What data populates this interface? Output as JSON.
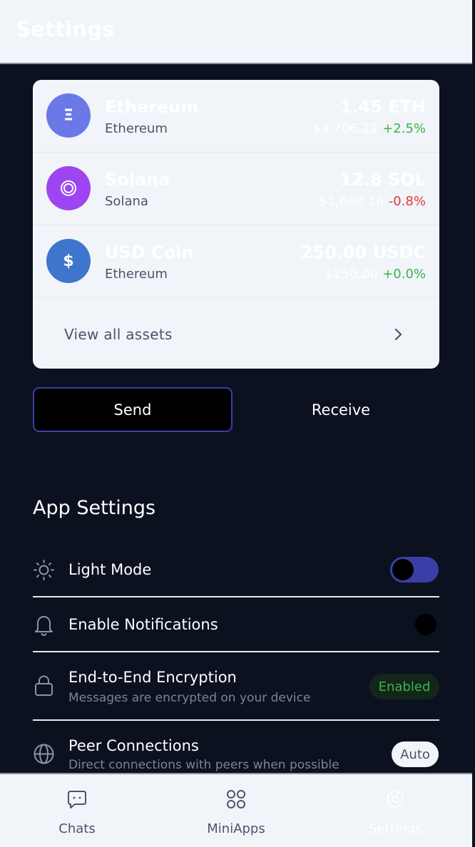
{
  "header": {
    "title": "Settings"
  },
  "assets": [
    {
      "name": "Ethereum",
      "network": "Ethereum",
      "amount": "1.45 ETH",
      "usd": "$4,706.22",
      "change": "+2.5%",
      "change_dir": "pos",
      "icon": "ethereum-icon",
      "icon_glyph": "Ξ",
      "color": "#6a78e8"
    },
    {
      "name": "Solana",
      "network": "Solana",
      "amount": "12.8 SOL",
      "usd": "$1,660.16",
      "change": "-0.8%",
      "change_dir": "neg",
      "icon": "solana-icon",
      "icon_glyph": "◎",
      "color": "#9d45f0"
    },
    {
      "name": "USD Coin",
      "network": "Ethereum",
      "amount": "250.00 USDC",
      "usd": "$250.00",
      "change": "+0.0%",
      "change_dir": "pos",
      "icon": "usd-coin-icon",
      "icon_glyph": "$",
      "color": "#3f75cc"
    }
  ],
  "view_all": {
    "label": "View all assets"
  },
  "actions": {
    "send": "Send",
    "receive": "Receive"
  },
  "app_settings": {
    "title": "App Settings",
    "light_mode": {
      "label": "Light Mode",
      "on": true
    },
    "notifications": {
      "label": "Enable Notifications",
      "on": false
    },
    "encryption": {
      "label": "End-to-End Encryption",
      "description": "Messages are encrypted on your device",
      "badge": "Enabled"
    },
    "peer": {
      "label": "Peer Connections",
      "description": "Direct connections with peers when possible",
      "badge": "Auto"
    }
  },
  "nav": {
    "items": [
      {
        "label": "Chats",
        "icon": "chat-icon"
      },
      {
        "label": "MiniApps",
        "icon": "miniapps-icon"
      },
      {
        "label": "Settings",
        "icon": "settings-icon",
        "active": true
      }
    ]
  },
  "colors": {
    "accent": "#3a3fa8",
    "positive": "#3cb44b",
    "negative": "#e23a3a",
    "background": "#0c1120",
    "card": "#f1f4f9"
  }
}
